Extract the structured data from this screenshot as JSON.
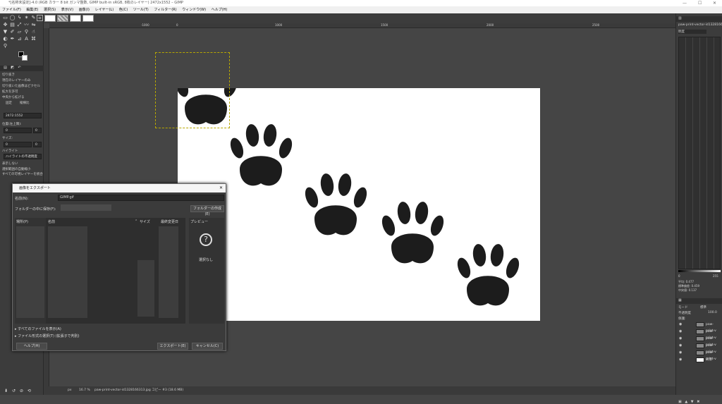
{
  "window": {
    "title": "*[名称未設定]-4.0 (RGB カラー 8 bit ガンマ整数, GIMP built-in sRGB, 8枚のレイヤー) 2472x1552 – GIMP",
    "minimize": "—",
    "maximize": "☐",
    "close": "✕"
  },
  "menu": [
    "ファイル(F)",
    "編集(E)",
    "選択(S)",
    "表示(V)",
    "画像(I)",
    "レイヤー(L)",
    "色(C)",
    "ツール(T)",
    "フィルター(R)",
    "ウィンドウ(W)",
    "ヘルプ(H)"
  ],
  "tool_options": {
    "mode_label": "切り抜き",
    "opt1": "現在のレイヤーのみ",
    "opt2": "切り抜いた画像はピクセル",
    "opt3": "拡大を許可",
    "opt4": "中央から拡げる",
    "fixed_label": "固定",
    "ratio": "縦横比",
    "size_value": "2472:1552",
    "position_label": "位置(左上隅):",
    "pos_x": "0",
    "pos_y": "0",
    "size_label": "サイズ:",
    "size_x": "0",
    "size_y": "0",
    "highlight": "ハイライト",
    "highlight_opacity": "ハイライトの不透明度",
    "guides": "表示しない",
    "auto_shrink": "選択範囲の自動縮小",
    "merged": "すべての可視レイヤーを統合"
  },
  "ruler": {
    "marks": [
      "-1000",
      "-500",
      "0",
      "500",
      "1000",
      "1500",
      "2000",
      "2500",
      "3000"
    ]
  },
  "statusbar": {
    "unit": "px",
    "zoom": "16.7 %",
    "info": "paw-print-vector-id1328166313.jpg コピー #3 (18.6 MB)"
  },
  "right_panel": {
    "header": "paw-print-vector-id1328166313",
    "channel": "明度",
    "slider_min": "0",
    "slider_max": "255",
    "stats": [
      "平均: 0.477",
      "標準偏差: 0.459",
      "中央値: 0.137",
      "ピクセル数: 合計",
      "合計ピクセル数",
      "パーセンタイル"
    ],
    "mode_label": "モード",
    "mode_value": "標準",
    "opacity_label": "不透明度",
    "opacity_value": "100.0",
    "lock_label": "保護:",
    "layers": [
      "paw-print-v",
      "paw-print-v",
      "paw-print-v",
      "paw-print-v",
      "paw-print-v",
      "背景"
    ]
  },
  "export_dialog": {
    "title": "画像をエクスポート",
    "name_label": "名前(N):",
    "name_value": "GIMP.gif",
    "folder_label": "フォルダーの中に保存(F):",
    "create_folder": "フォルダーの作成(E)",
    "places_header": "場所(P)",
    "col_name": "名前",
    "col_size": "サイズ",
    "col_modified": "最終変更日",
    "preview_header": "プレビュー",
    "no_selection": "選択なし",
    "show_all_files": "すべてのファイルを表示(A)",
    "file_type": "ファイル形式の選択(T) (拡張子で判別)",
    "help": "ヘルプ(H)",
    "export": "エクスポート(E)",
    "cancel": "キャンセル(C)"
  },
  "colors": {
    "background": "#454545",
    "canvas": "#ffffff",
    "paw": "#1c1c1c",
    "selection": "#b8a800"
  }
}
